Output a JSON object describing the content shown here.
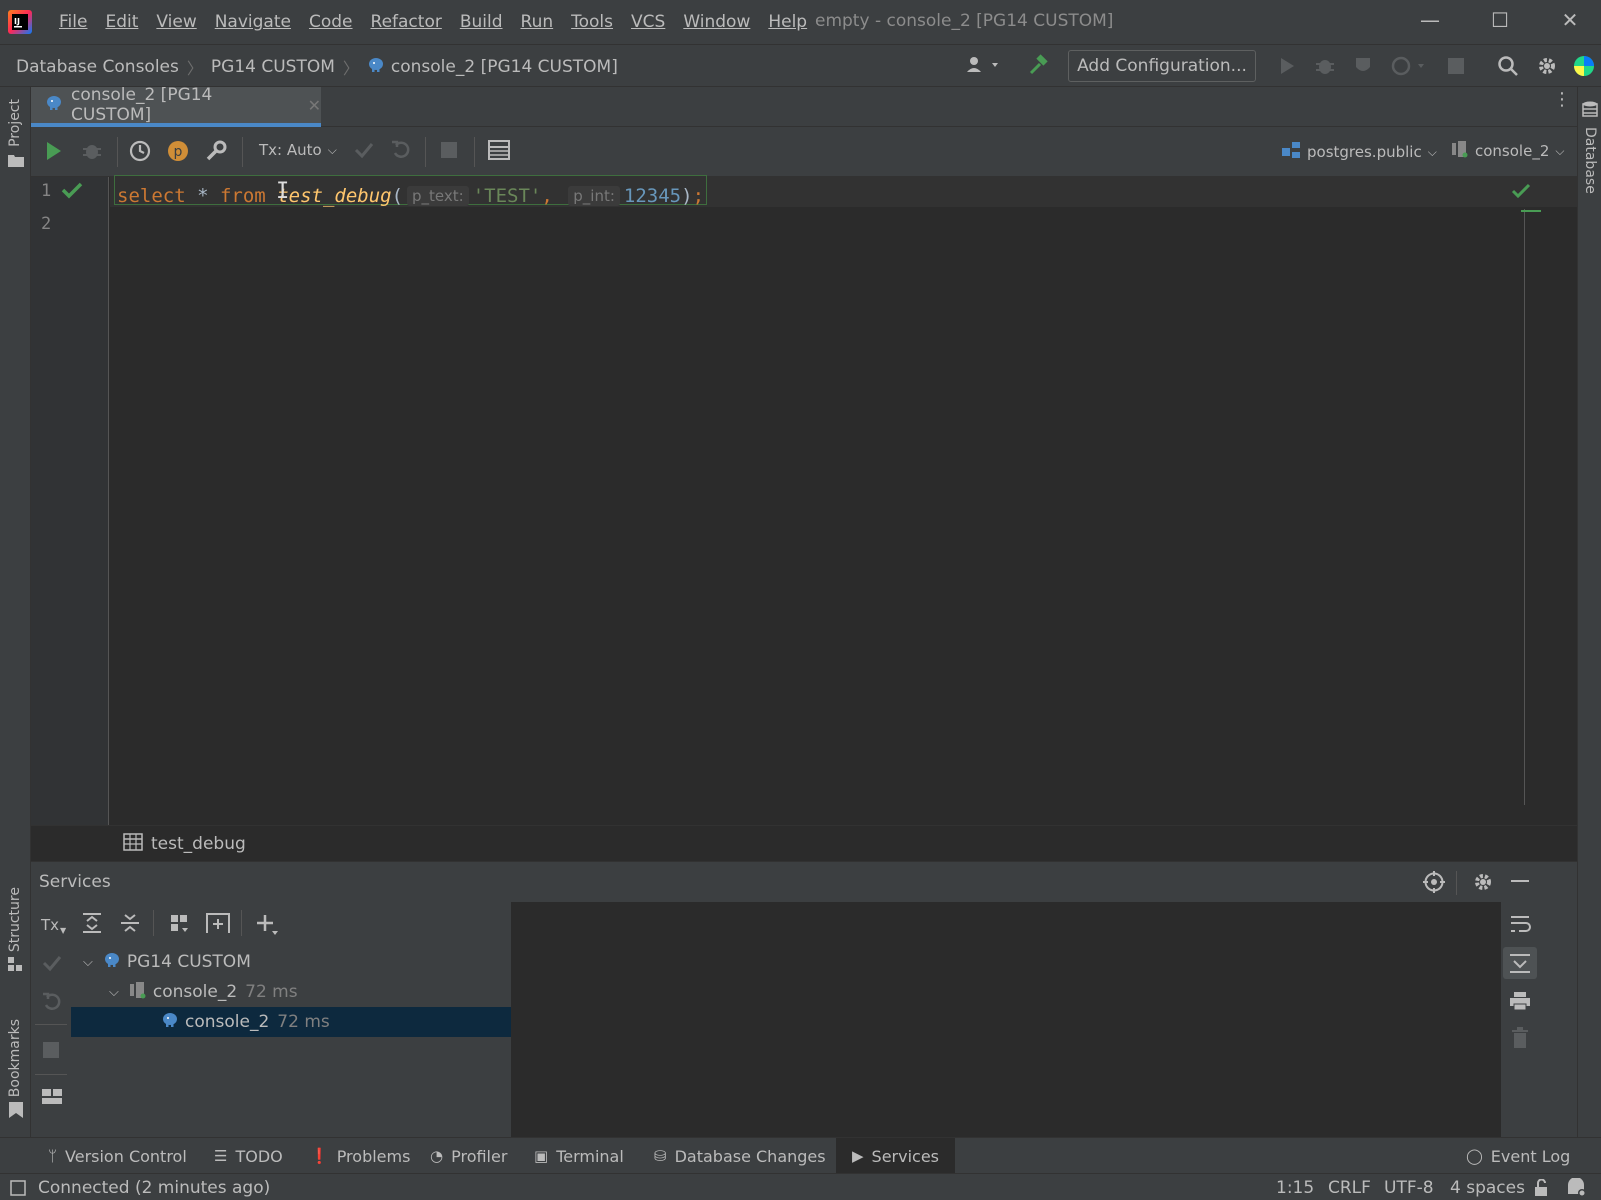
{
  "titlebar": {
    "menu": [
      "File",
      "Edit",
      "View",
      "Navigate",
      "Code",
      "Refactor",
      "Build",
      "Run",
      "Tools",
      "VCS",
      "Window",
      "Help"
    ],
    "window_title": "empty - console_2 [PG14 CUSTOM]"
  },
  "navbar": {
    "crumbs": [
      "Database Consoles",
      "PG14 CUSTOM",
      "console_2 [PG14 CUSTOM]"
    ],
    "add_configuration": "Add Configuration..."
  },
  "left_strip": {
    "project": "Project",
    "structure": "Structure",
    "bookmarks": "Bookmarks"
  },
  "right_strip": {
    "database": "Database"
  },
  "editor_tab": {
    "label": "console_2 [PG14 CUSTOM]"
  },
  "console_toolbar": {
    "tx_mode": "Tx: Auto",
    "schema": "postgres.public",
    "session": "console_2"
  },
  "editor": {
    "line_numbers": [
      "1",
      "2"
    ],
    "code": {
      "kw1": "select",
      "star": " * ",
      "kw2": "from",
      "fn": "test_debug",
      "open": "(",
      "hint1": "p_text:",
      "str": "'TEST'",
      "comma": ",",
      "hint2": "p_int:",
      "num": "12345",
      "close": ")",
      "semi": ";"
    }
  },
  "editor_breadcrumb": {
    "label": "test_debug"
  },
  "services": {
    "title": "Services",
    "tx_label": "Tx",
    "tree": [
      {
        "label": "PG14 CUSTOM",
        "time": ""
      },
      {
        "label": "console_2",
        "time": "72 ms"
      },
      {
        "label": "console_2",
        "time": "72 ms"
      }
    ]
  },
  "bottom_tabs": [
    "Version Control",
    "TODO",
    "Problems",
    "Profiler",
    "Terminal",
    "Database Changes",
    "Services",
    "Event Log"
  ],
  "status": {
    "message": "Connected (2 minutes ago)",
    "position": "1:15",
    "line_sep": "CRLF",
    "encoding": "UTF-8",
    "indent": "4 spaces"
  },
  "colors": {
    "accent": "#4a88c7",
    "run_green": "#499c54",
    "keyword": "#cc7832",
    "function": "#ffc66d",
    "string": "#6a8759",
    "number": "#6897bb",
    "selection": "#0d293e"
  }
}
